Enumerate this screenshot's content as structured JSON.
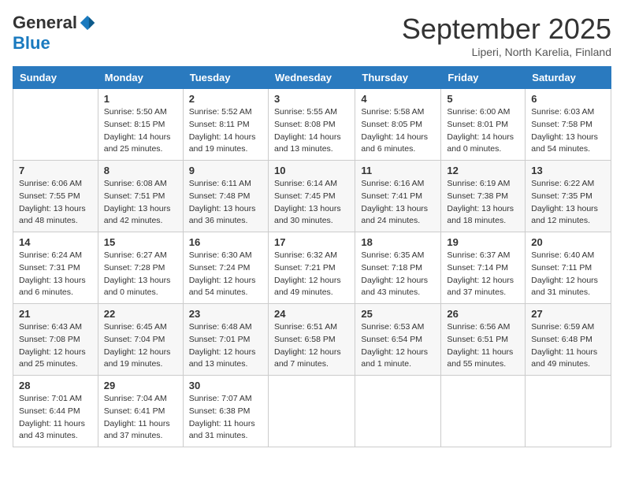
{
  "header": {
    "logo_general": "General",
    "logo_blue": "Blue",
    "month_title": "September 2025",
    "location": "Liperi, North Karelia, Finland"
  },
  "days_of_week": [
    "Sunday",
    "Monday",
    "Tuesday",
    "Wednesday",
    "Thursday",
    "Friday",
    "Saturday"
  ],
  "weeks": [
    [
      {
        "day": "",
        "info": ""
      },
      {
        "day": "1",
        "info": "Sunrise: 5:50 AM\nSunset: 8:15 PM\nDaylight: 14 hours\nand 25 minutes."
      },
      {
        "day": "2",
        "info": "Sunrise: 5:52 AM\nSunset: 8:11 PM\nDaylight: 14 hours\nand 19 minutes."
      },
      {
        "day": "3",
        "info": "Sunrise: 5:55 AM\nSunset: 8:08 PM\nDaylight: 14 hours\nand 13 minutes."
      },
      {
        "day": "4",
        "info": "Sunrise: 5:58 AM\nSunset: 8:05 PM\nDaylight: 14 hours\nand 6 minutes."
      },
      {
        "day": "5",
        "info": "Sunrise: 6:00 AM\nSunset: 8:01 PM\nDaylight: 14 hours\nand 0 minutes."
      },
      {
        "day": "6",
        "info": "Sunrise: 6:03 AM\nSunset: 7:58 PM\nDaylight: 13 hours\nand 54 minutes."
      }
    ],
    [
      {
        "day": "7",
        "info": "Sunrise: 6:06 AM\nSunset: 7:55 PM\nDaylight: 13 hours\nand 48 minutes."
      },
      {
        "day": "8",
        "info": "Sunrise: 6:08 AM\nSunset: 7:51 PM\nDaylight: 13 hours\nand 42 minutes."
      },
      {
        "day": "9",
        "info": "Sunrise: 6:11 AM\nSunset: 7:48 PM\nDaylight: 13 hours\nand 36 minutes."
      },
      {
        "day": "10",
        "info": "Sunrise: 6:14 AM\nSunset: 7:45 PM\nDaylight: 13 hours\nand 30 minutes."
      },
      {
        "day": "11",
        "info": "Sunrise: 6:16 AM\nSunset: 7:41 PM\nDaylight: 13 hours\nand 24 minutes."
      },
      {
        "day": "12",
        "info": "Sunrise: 6:19 AM\nSunset: 7:38 PM\nDaylight: 13 hours\nand 18 minutes."
      },
      {
        "day": "13",
        "info": "Sunrise: 6:22 AM\nSunset: 7:35 PM\nDaylight: 13 hours\nand 12 minutes."
      }
    ],
    [
      {
        "day": "14",
        "info": "Sunrise: 6:24 AM\nSunset: 7:31 PM\nDaylight: 13 hours\nand 6 minutes."
      },
      {
        "day": "15",
        "info": "Sunrise: 6:27 AM\nSunset: 7:28 PM\nDaylight: 13 hours\nand 0 minutes."
      },
      {
        "day": "16",
        "info": "Sunrise: 6:30 AM\nSunset: 7:24 PM\nDaylight: 12 hours\nand 54 minutes."
      },
      {
        "day": "17",
        "info": "Sunrise: 6:32 AM\nSunset: 7:21 PM\nDaylight: 12 hours\nand 49 minutes."
      },
      {
        "day": "18",
        "info": "Sunrise: 6:35 AM\nSunset: 7:18 PM\nDaylight: 12 hours\nand 43 minutes."
      },
      {
        "day": "19",
        "info": "Sunrise: 6:37 AM\nSunset: 7:14 PM\nDaylight: 12 hours\nand 37 minutes."
      },
      {
        "day": "20",
        "info": "Sunrise: 6:40 AM\nSunset: 7:11 PM\nDaylight: 12 hours\nand 31 minutes."
      }
    ],
    [
      {
        "day": "21",
        "info": "Sunrise: 6:43 AM\nSunset: 7:08 PM\nDaylight: 12 hours\nand 25 minutes."
      },
      {
        "day": "22",
        "info": "Sunrise: 6:45 AM\nSunset: 7:04 PM\nDaylight: 12 hours\nand 19 minutes."
      },
      {
        "day": "23",
        "info": "Sunrise: 6:48 AM\nSunset: 7:01 PM\nDaylight: 12 hours\nand 13 minutes."
      },
      {
        "day": "24",
        "info": "Sunrise: 6:51 AM\nSunset: 6:58 PM\nDaylight: 12 hours\nand 7 minutes."
      },
      {
        "day": "25",
        "info": "Sunrise: 6:53 AM\nSunset: 6:54 PM\nDaylight: 12 hours\nand 1 minute."
      },
      {
        "day": "26",
        "info": "Sunrise: 6:56 AM\nSunset: 6:51 PM\nDaylight: 11 hours\nand 55 minutes."
      },
      {
        "day": "27",
        "info": "Sunrise: 6:59 AM\nSunset: 6:48 PM\nDaylight: 11 hours\nand 49 minutes."
      }
    ],
    [
      {
        "day": "28",
        "info": "Sunrise: 7:01 AM\nSunset: 6:44 PM\nDaylight: 11 hours\nand 43 minutes."
      },
      {
        "day": "29",
        "info": "Sunrise: 7:04 AM\nSunset: 6:41 PM\nDaylight: 11 hours\nand 37 minutes."
      },
      {
        "day": "30",
        "info": "Sunrise: 7:07 AM\nSunset: 6:38 PM\nDaylight: 11 hours\nand 31 minutes."
      },
      {
        "day": "",
        "info": ""
      },
      {
        "day": "",
        "info": ""
      },
      {
        "day": "",
        "info": ""
      },
      {
        "day": "",
        "info": ""
      }
    ]
  ]
}
